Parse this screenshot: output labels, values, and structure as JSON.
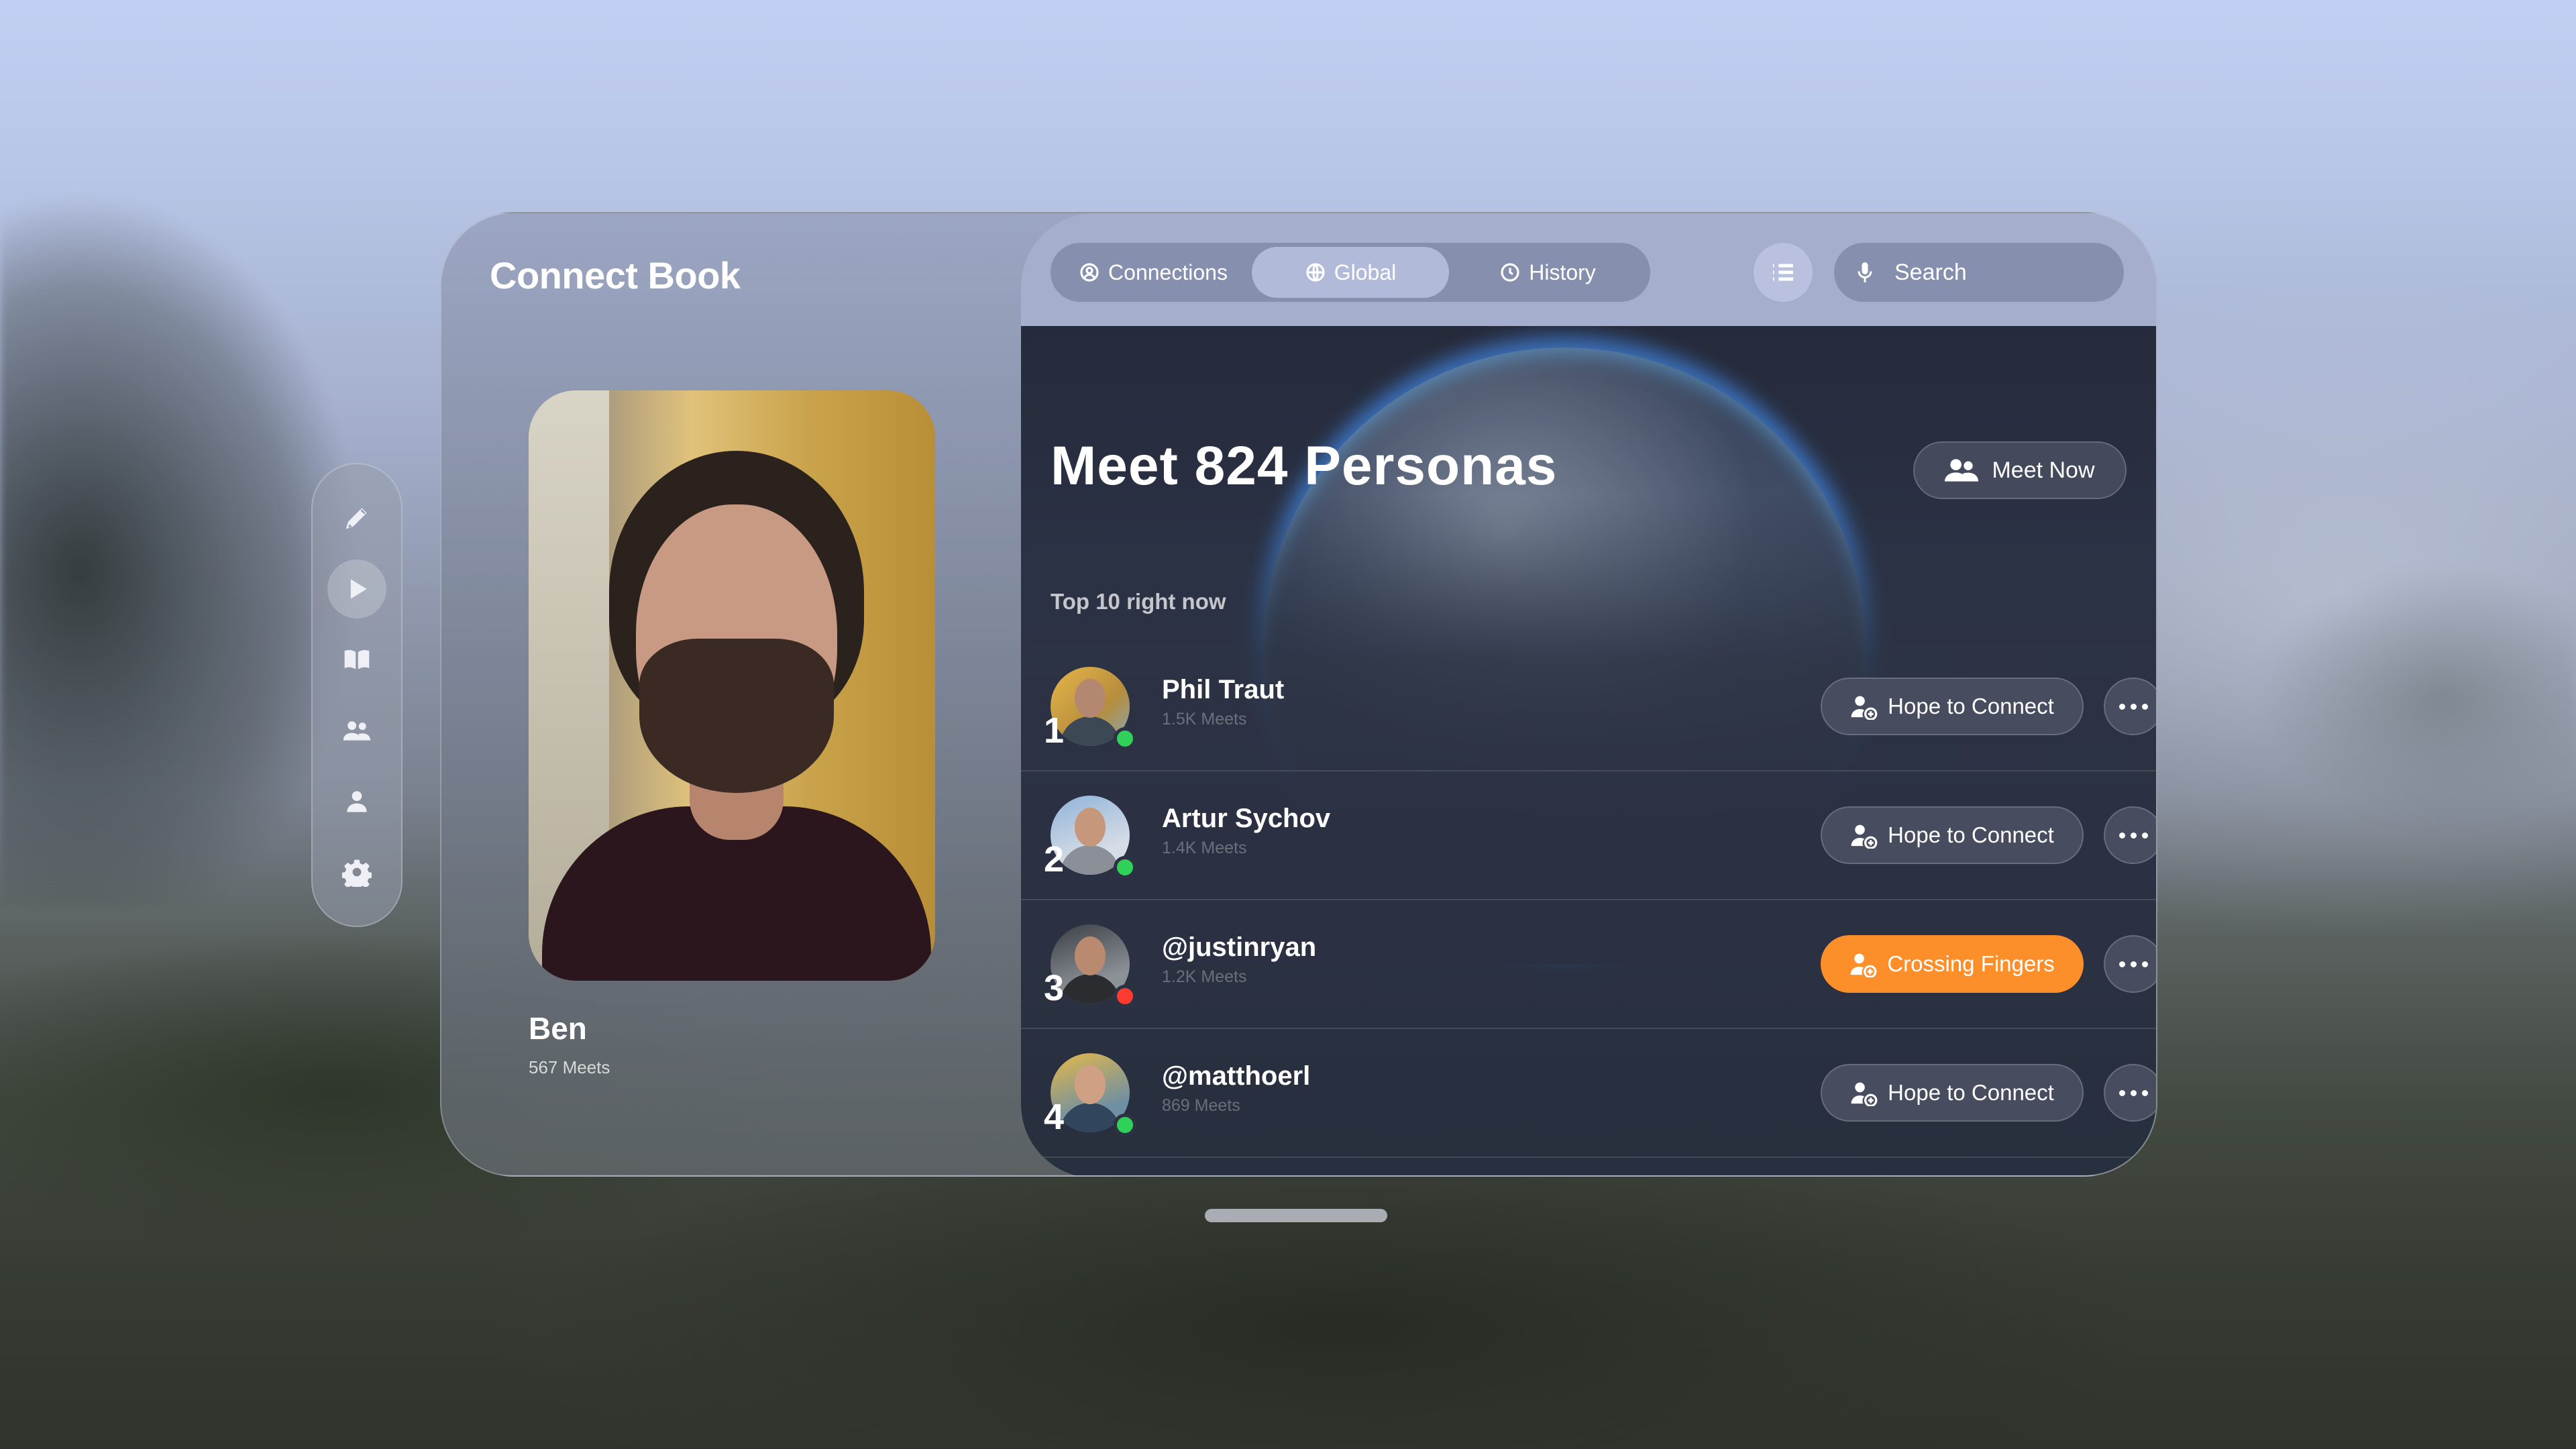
{
  "app": {
    "title": "Connect Book"
  },
  "profile": {
    "name": "Ben",
    "meets": "567 Meets"
  },
  "rail": {
    "items": [
      {
        "icon": "pen-icon"
      },
      {
        "icon": "play-icon",
        "active": true
      },
      {
        "icon": "book-icon"
      },
      {
        "icon": "people-icon"
      },
      {
        "icon": "person-icon"
      },
      {
        "icon": "gear-icon"
      }
    ]
  },
  "tabs": [
    {
      "label": "Connections",
      "icon": "connections-icon"
    },
    {
      "label": "Global",
      "icon": "globe-icon",
      "active": true
    },
    {
      "label": "History",
      "icon": "clock-icon"
    }
  ],
  "search": {
    "placeholder": "Search"
  },
  "hero": {
    "title": "Meet 824 Personas",
    "meet_now_label": "Meet Now"
  },
  "section": {
    "title": "Top 10 right now"
  },
  "rows": [
    {
      "rank": "1",
      "name": "Phil Traut",
      "meets": "1.5K Meets",
      "status": "online",
      "status_color": "#30d158",
      "action": "Hope to Connect"
    },
    {
      "rank": "2",
      "name": "Artur Sychov",
      "meets": "1.4K Meets",
      "status": "online",
      "status_color": "#30d158",
      "action": "Hope to Connect"
    },
    {
      "rank": "3",
      "name": "@justinryan",
      "meets": "1.2K Meets",
      "status": "busy",
      "status_color": "#ff3b30",
      "action": "Crossing Fingers",
      "highlight": true
    },
    {
      "rank": "4",
      "name": "@matthoerl",
      "meets": "869 Meets",
      "status": "online",
      "status_color": "#30d158",
      "action": "Hope to Connect"
    }
  ],
  "colors": {
    "accent_orange": "#fd8f2a",
    "online": "#30d158",
    "busy": "#ff3b30"
  }
}
